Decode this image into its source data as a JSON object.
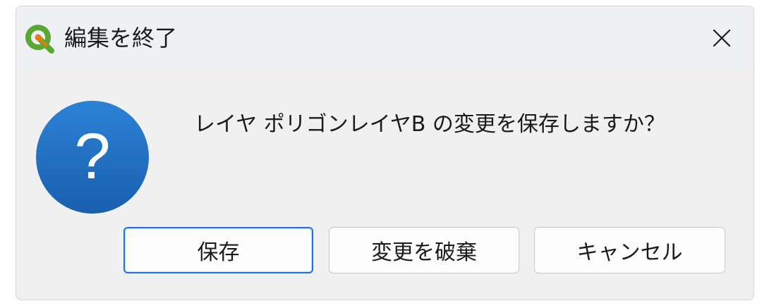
{
  "window": {
    "title": "編集を終了",
    "app_icon": "qgis-logo-icon",
    "close_icon": "close-icon"
  },
  "dialog": {
    "icon": "question-icon",
    "icon_glyph": "?",
    "message": "レイヤ ポリゴンレイヤB の変更を保存しますか？"
  },
  "buttons": {
    "save_label": "保存",
    "discard_label": "変更を破棄",
    "cancel_label": "キャンセル"
  },
  "colors": {
    "question_icon_blue": "#1f6fc4",
    "default_button_border": "#1a73e8",
    "qgis_green": "#5aa832",
    "qgis_orange": "#ee7913"
  }
}
